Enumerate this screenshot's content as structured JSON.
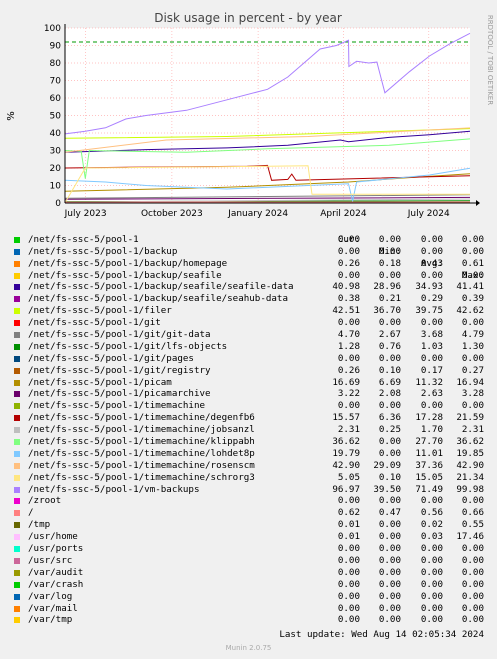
{
  "chart_data": {
    "type": "line",
    "title": "Disk usage in percent - by year",
    "ylabel": "%",
    "side_label": "RRDTOOL / TOBI OETIKER",
    "ylim": [
      0,
      100
    ],
    "yticks": [
      "0",
      "10",
      "20",
      "30",
      "40",
      "50",
      "60",
      "70",
      "80",
      "90",
      "100"
    ],
    "xlim": [
      "2023-06-09",
      "2024-08-14"
    ],
    "xticks": [
      {
        "date": "2023-07-01",
        "label": "July 2023"
      },
      {
        "date": "2023-10-01",
        "label": "October 2023"
      },
      {
        "date": "2024-01-01",
        "label": "January 2024"
      },
      {
        "date": "2024-04-01",
        "label": "April 2024"
      },
      {
        "date": "2024-07-01",
        "label": "July 2024"
      }
    ],
    "grid": true,
    "threshold": 92,
    "columns": [
      "Cur:",
      "Min:",
      "Avg:",
      "Max:"
    ],
    "series": [
      {
        "name": "/net/fs-ssc-5/pool-1",
        "color": "#00cc00",
        "cur": "0.00",
        "min": "0.00",
        "avg": "0.00",
        "max": "0.00",
        "y": [
          [
            0,
            0
          ],
          [
            1,
            0
          ]
        ]
      },
      {
        "name": "/net/fs-ssc-5/pool-1/backup",
        "color": "#0066b3",
        "cur": "0.00",
        "min": "0.00",
        "avg": "0.00",
        "max": "0.00",
        "y": [
          [
            0,
            0
          ],
          [
            1,
            0
          ]
        ]
      },
      {
        "name": "/net/fs-ssc-5/pool-1/backup/homepage",
        "color": "#ff8000",
        "cur": "0.26",
        "min": "0.18",
        "avg": "0.43",
        "max": "0.61",
        "y": [
          [
            0,
            0.5
          ],
          [
            1,
            0.26
          ]
        ]
      },
      {
        "name": "/net/fs-ssc-5/pool-1/backup/seafile",
        "color": "#ffcc00",
        "cur": "0.00",
        "min": "0.00",
        "avg": "0.00",
        "max": "0.00",
        "y": [
          [
            0,
            0
          ],
          [
            1,
            0
          ]
        ]
      },
      {
        "name": "/net/fs-ssc-5/pool-1/backup/seafile/seafile-data",
        "color": "#330099",
        "cur": "40.98",
        "min": "28.96",
        "avg": "34.93",
        "max": "41.41",
        "y": [
          [
            0,
            29
          ],
          [
            0.2,
            30.5
          ],
          [
            0.4,
            31.5
          ],
          [
            0.55,
            33
          ],
          [
            0.68,
            36
          ],
          [
            0.7,
            35
          ],
          [
            0.8,
            37.5
          ],
          [
            0.9,
            39
          ],
          [
            1,
            41
          ]
        ]
      },
      {
        "name": "/net/fs-ssc-5/pool-1/backup/seafile/seahub-data",
        "color": "#990099",
        "cur": "0.38",
        "min": "0.21",
        "avg": "0.29",
        "max": "0.39",
        "y": [
          [
            0,
            0.3
          ],
          [
            1,
            0.38
          ]
        ]
      },
      {
        "name": "/net/fs-ssc-5/pool-1/filer",
        "color": "#ccff00",
        "cur": "42.51",
        "min": "36.70",
        "avg": "39.75",
        "max": "42.62",
        "y": [
          [
            0,
            37
          ],
          [
            0.4,
            38
          ],
          [
            0.6,
            39.5
          ],
          [
            0.8,
            41
          ],
          [
            1,
            42.5
          ]
        ]
      },
      {
        "name": "/net/fs-ssc-5/pool-1/git",
        "color": "#ff0000",
        "cur": "0.00",
        "min": "0.00",
        "avg": "0.00",
        "max": "0.00",
        "y": [
          [
            0,
            0
          ],
          [
            1,
            0
          ]
        ]
      },
      {
        "name": "/net/fs-ssc-5/pool-1/git/git-data",
        "color": "#808080",
        "cur": "4.70",
        "min": "2.67",
        "avg": "3.68",
        "max": "4.79",
        "y": [
          [
            0,
            2.7
          ],
          [
            1,
            4.7
          ]
        ]
      },
      {
        "name": "/net/fs-ssc-5/pool-1/git/lfs-objects",
        "color": "#008f00",
        "cur": "1.28",
        "min": "0.76",
        "avg": "1.03",
        "max": "1.30",
        "y": [
          [
            0,
            0.8
          ],
          [
            1,
            1.28
          ]
        ]
      },
      {
        "name": "/net/fs-ssc-5/pool-1/git/pages",
        "color": "#00487d",
        "cur": "0.00",
        "min": "0.00",
        "avg": "0.00",
        "max": "0.00",
        "y": [
          [
            0,
            0
          ],
          [
            1,
            0
          ]
        ]
      },
      {
        "name": "/net/fs-ssc-5/pool-1/git/registry",
        "color": "#b35a00",
        "cur": "0.26",
        "min": "0.10",
        "avg": "0.17",
        "max": "0.27",
        "y": [
          [
            0,
            0.1
          ],
          [
            1,
            0.26
          ]
        ]
      },
      {
        "name": "/net/fs-ssc-5/pool-1/picam",
        "color": "#b38f00",
        "cur": "16.69",
        "min": "6.69",
        "avg": "11.32",
        "max": "16.94",
        "y": [
          [
            0,
            6.7
          ],
          [
            0.4,
            9
          ],
          [
            0.7,
            12
          ],
          [
            0.85,
            14.5
          ],
          [
            1,
            16.7
          ]
        ]
      },
      {
        "name": "/net/fs-ssc-5/pool-1/picamarchive",
        "color": "#6b006b",
        "cur": "3.22",
        "min": "2.08",
        "avg": "2.63",
        "max": "3.28",
        "y": [
          [
            0,
            2.1
          ],
          [
            1,
            3.2
          ]
        ]
      },
      {
        "name": "/net/fs-ssc-5/pool-1/timemachine",
        "color": "#8fb300",
        "cur": "0.00",
        "min": "0.00",
        "avg": "0.00",
        "max": "0.00",
        "y": [
          [
            0,
            0
          ],
          [
            1,
            0
          ]
        ]
      },
      {
        "name": "/net/fs-ssc-5/pool-1/timemachine/degenfb6",
        "color": "#b30000",
        "cur": "15.57",
        "min": "6.36",
        "avg": "17.28",
        "max": "21.59",
        "y": [
          [
            0,
            20
          ],
          [
            0.2,
            20.5
          ],
          [
            0.45,
            21
          ],
          [
            0.5,
            21.5
          ],
          [
            0.51,
            13
          ],
          [
            0.55,
            13.5
          ],
          [
            0.56,
            16.5
          ],
          [
            0.57,
            13
          ],
          [
            1,
            15.6
          ]
        ]
      },
      {
        "name": "/net/fs-ssc-5/pool-1/timemachine/jobsanzl",
        "color": "#bebebe",
        "cur": "2.31",
        "min": "0.25",
        "avg": "1.70",
        "max": "2.31",
        "y": [
          [
            0,
            0.5
          ],
          [
            1,
            2.3
          ]
        ]
      },
      {
        "name": "/net/fs-ssc-5/pool-1/timemachine/klippabh",
        "color": "#80ff80",
        "cur": "36.62",
        "min": "0.00",
        "avg": "27.70",
        "max": "36.62",
        "y": [
          [
            0,
            30
          ],
          [
            0.04,
            29.5
          ],
          [
            0.05,
            14
          ],
          [
            0.06,
            30
          ],
          [
            0.3,
            29
          ],
          [
            0.5,
            31
          ],
          [
            0.8,
            33
          ],
          [
            1,
            36.6
          ]
        ]
      },
      {
        "name": "/net/fs-ssc-5/pool-1/timemachine/lohdet8p",
        "color": "#80c9ff",
        "cur": "19.79",
        "min": "0.00",
        "avg": "11.01",
        "max": "19.85",
        "y": [
          [
            0,
            13
          ],
          [
            0.1,
            12
          ],
          [
            0.2,
            10
          ],
          [
            0.4,
            8
          ],
          [
            0.6,
            10
          ],
          [
            0.7,
            11
          ],
          [
            0.71,
            1
          ],
          [
            0.72,
            12
          ],
          [
            0.9,
            16
          ],
          [
            1,
            19.8
          ]
        ]
      },
      {
        "name": "/net/fs-ssc-5/pool-1/timemachine/rosenscm",
        "color": "#ffc080",
        "cur": "42.90",
        "min": "29.09",
        "avg": "37.36",
        "max": "42.90",
        "y": [
          [
            0,
            29
          ],
          [
            0.25,
            36
          ],
          [
            0.6,
            38
          ],
          [
            0.8,
            40.5
          ],
          [
            1,
            42.9
          ]
        ]
      },
      {
        "name": "/net/fs-ssc-5/pool-1/timemachine/schrorg3",
        "color": "#ffe680",
        "cur": "5.05",
        "min": "0.10",
        "avg": "15.05",
        "max": "21.34",
        "y": [
          [
            0,
            0.1
          ],
          [
            0.05,
            20
          ],
          [
            0.5,
            21
          ],
          [
            0.6,
            21.3
          ],
          [
            0.61,
            5
          ],
          [
            1,
            5.05
          ]
        ]
      },
      {
        "name": "/net/fs-ssc-5/pool-1/vm-backups",
        "color": "#aa80ff",
        "cur": "96.97",
        "min": "39.50",
        "avg": "71.49",
        "max": "99.98",
        "y": [
          [
            0,
            39.5
          ],
          [
            0.05,
            41
          ],
          [
            0.1,
            43
          ],
          [
            0.15,
            48
          ],
          [
            0.2,
            50
          ],
          [
            0.3,
            53
          ],
          [
            0.4,
            59
          ],
          [
            0.5,
            65
          ],
          [
            0.55,
            72
          ],
          [
            0.6,
            82
          ],
          [
            0.63,
            88
          ],
          [
            0.67,
            90
          ],
          [
            0.7,
            93
          ],
          [
            0.701,
            78
          ],
          [
            0.72,
            81
          ],
          [
            0.75,
            80
          ],
          [
            0.77,
            80.5
          ],
          [
            0.79,
            63
          ],
          [
            0.85,
            75
          ],
          [
            0.9,
            84
          ],
          [
            0.95,
            91
          ],
          [
            1,
            97
          ]
        ]
      },
      {
        "name": "/zroot",
        "color": "#ee00cc",
        "cur": "0.00",
        "min": "0.00",
        "avg": "0.00",
        "max": "0.00",
        "y": [
          [
            0,
            0
          ],
          [
            1,
            0
          ]
        ]
      },
      {
        "name": "/",
        "color": "#ff8080",
        "cur": "0.62",
        "min": "0.47",
        "avg": "0.56",
        "max": "0.66",
        "y": [
          [
            0,
            0.5
          ],
          [
            1,
            0.62
          ]
        ]
      },
      {
        "name": "/tmp",
        "color": "#666600",
        "cur": "0.01",
        "min": "0.00",
        "avg": "0.02",
        "max": "0.55",
        "y": [
          [
            0,
            0
          ],
          [
            1,
            0.01
          ]
        ]
      },
      {
        "name": "/usr/home",
        "color": "#ffbfff",
        "cur": "0.01",
        "min": "0.00",
        "avg": "0.03",
        "max": "17.46",
        "y": [
          [
            0,
            0
          ],
          [
            1,
            0.01
          ]
        ]
      },
      {
        "name": "/usr/ports",
        "color": "#00ffcc",
        "cur": "0.00",
        "min": "0.00",
        "avg": "0.00",
        "max": "0.00",
        "y": [
          [
            0,
            0
          ],
          [
            1,
            0
          ]
        ]
      },
      {
        "name": "/usr/src",
        "color": "#cc6699",
        "cur": "0.00",
        "min": "0.00",
        "avg": "0.00",
        "max": "0.00",
        "y": [
          [
            0,
            0
          ],
          [
            1,
            0
          ]
        ]
      },
      {
        "name": "/var/audit",
        "color": "#999900",
        "cur": "0.00",
        "min": "0.00",
        "avg": "0.00",
        "max": "0.00",
        "y": [
          [
            0,
            0
          ],
          [
            1,
            0
          ]
        ]
      },
      {
        "name": "/var/crash",
        "color": "#00cc00",
        "cur": "0.00",
        "min": "0.00",
        "avg": "0.00",
        "max": "0.00",
        "y": [
          [
            0,
            0
          ],
          [
            1,
            0
          ]
        ]
      },
      {
        "name": "/var/log",
        "color": "#0066b3",
        "cur": "0.00",
        "min": "0.00",
        "avg": "0.00",
        "max": "0.00",
        "y": [
          [
            0,
            0
          ],
          [
            1,
            0
          ]
        ]
      },
      {
        "name": "/var/mail",
        "color": "#ff8000",
        "cur": "0.00",
        "min": "0.00",
        "avg": "0.00",
        "max": "0.00",
        "y": [
          [
            0,
            0
          ],
          [
            1,
            0
          ]
        ]
      },
      {
        "name": "/var/tmp",
        "color": "#ffcc00",
        "cur": "0.00",
        "min": "0.00",
        "avg": "0.00",
        "max": "0.00",
        "y": [
          [
            0,
            0
          ],
          [
            1,
            0
          ]
        ]
      }
    ]
  },
  "footer": {
    "last_update": "Last update:  Wed Aug 14 02:05:34 2024",
    "version": "Munin 2.0.75"
  }
}
